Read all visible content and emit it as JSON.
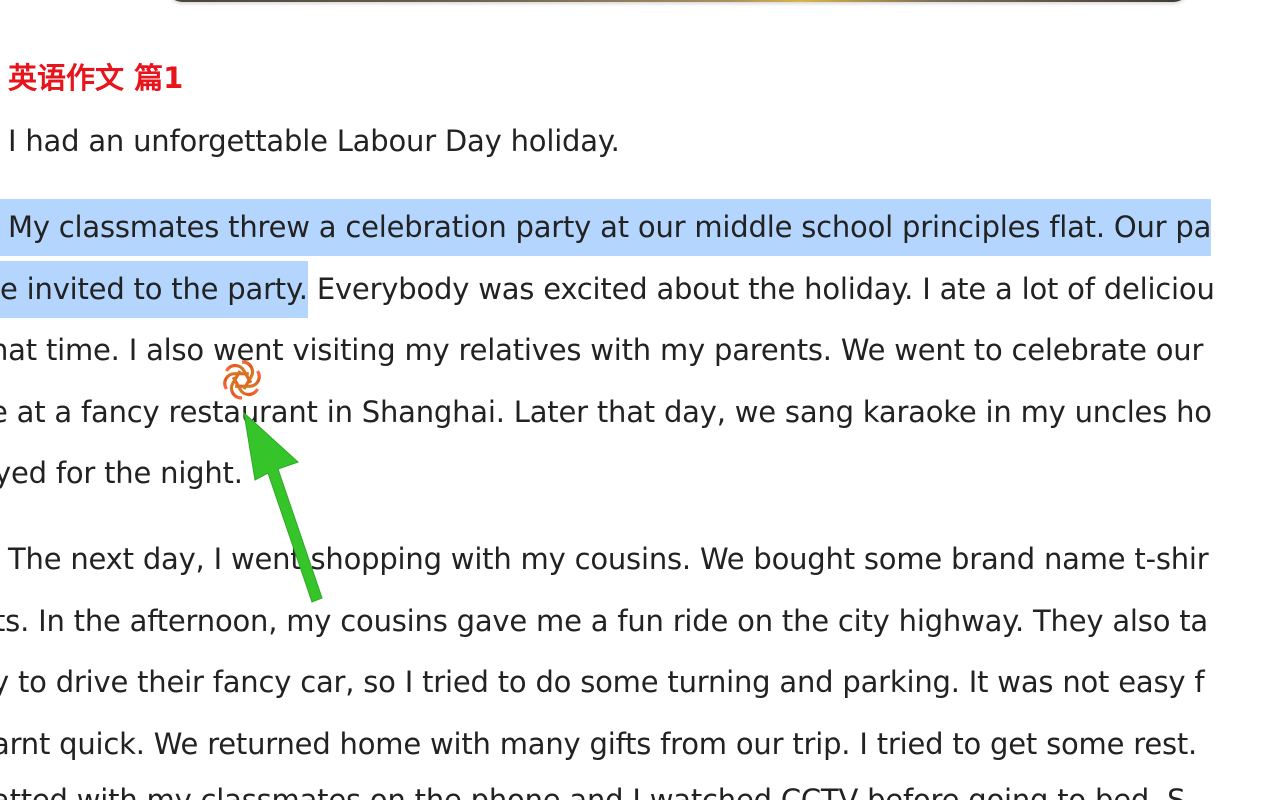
{
  "heading": "英语作文 篇1",
  "paragraph1": {
    "line1": "I had an unforgettable Labour Day holiday."
  },
  "paragraph2": {
    "line1_selected": "My classmates threw a celebration party at our middle school principles flat. Our pa",
    "line2_selected": "e invited to the party.",
    "line2_rest": " Everybody was excited about the holiday. I ate a lot of deliciou",
    "line3": "hat time. I also went visiting my relatives with my parents. We went to celebrate our",
    "line4": "e at a fancy restaurant in Shanghai. Later that day, we sang karaoke in my uncles ho",
    "line5": "yed for the night."
  },
  "paragraph3": {
    "line1": "The next day, I went shopping with my cousins. We bought some brand name t-shir",
    "line2": "ts. In the afternoon, my cousins gave me a fun ride on the city highway. They also ta",
    "line3": "y to drive their fancy car, so I tried to do some turning and parking. It was not easy f",
    "line4": "arnt quick. We returned home with many gifts from our trip. I tried to get some rest.",
    "line5": "atted with my classmates on the phone and I watched CCTV before going to bed. S"
  },
  "icons": {
    "assistant": "openai-logo-icon",
    "pointer": "green-arrow-icon"
  },
  "colors": {
    "heading": "#e8141c",
    "selection": "#b4d5fe",
    "text": "#222222",
    "arrow": "#35c52a"
  }
}
